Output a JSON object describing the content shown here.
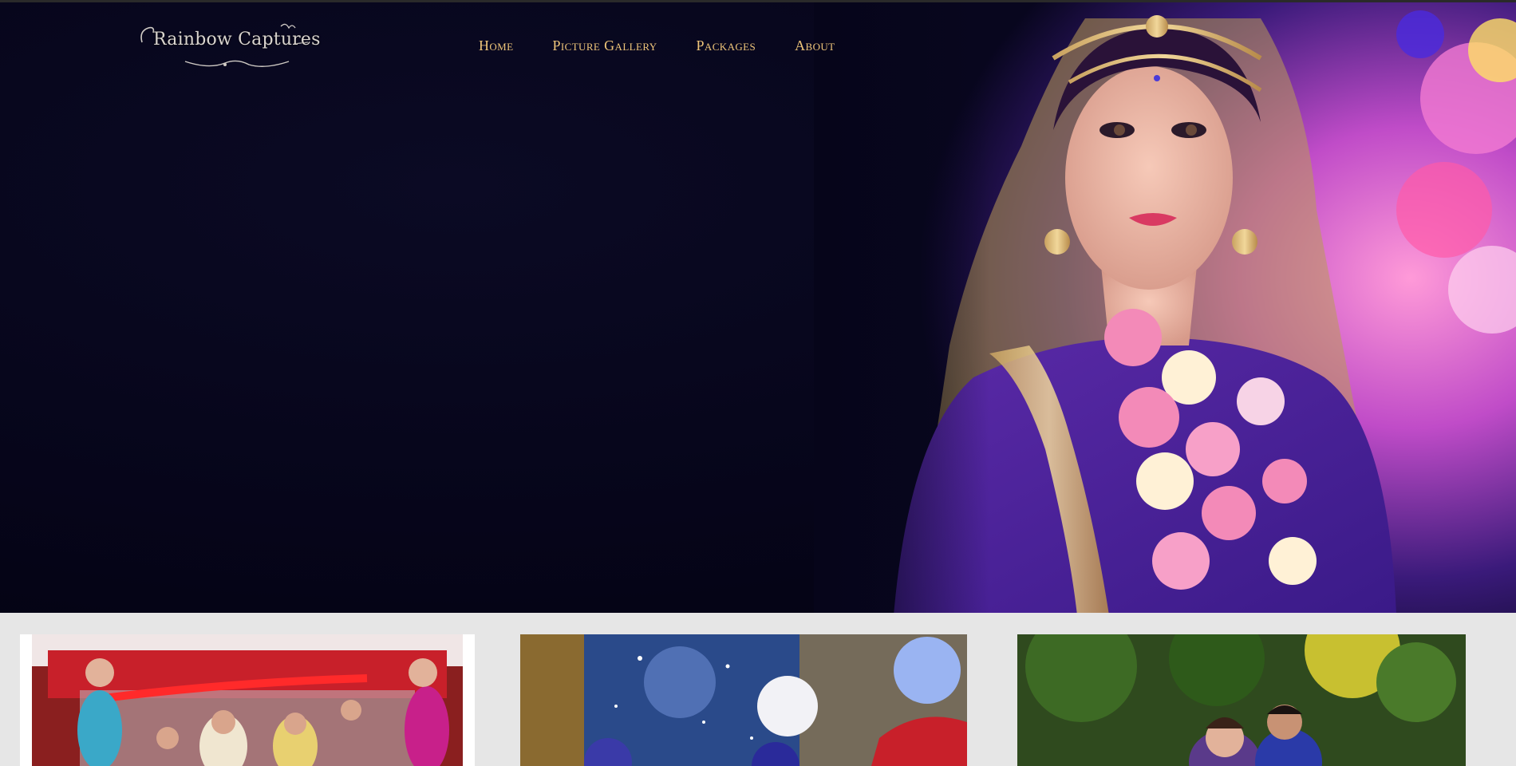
{
  "brand": {
    "logo_text": "Rainbow Captures"
  },
  "nav": {
    "items": [
      {
        "label": "Home"
      },
      {
        "label": "Picture Gallery"
      },
      {
        "label": "Packages"
      },
      {
        "label": "About"
      }
    ]
  },
  "colors": {
    "nav_text": "#f0c67a",
    "hero_background": "#06051a",
    "page_background": "#e6e6e6"
  },
  "hero": {
    "image": "bride-portrait"
  },
  "gallery": {
    "cards": [
      {
        "image": "wedding-ceremony-photo"
      },
      {
        "image": "balloons-photo"
      },
      {
        "image": "couple-outdoor-photo"
      }
    ]
  }
}
